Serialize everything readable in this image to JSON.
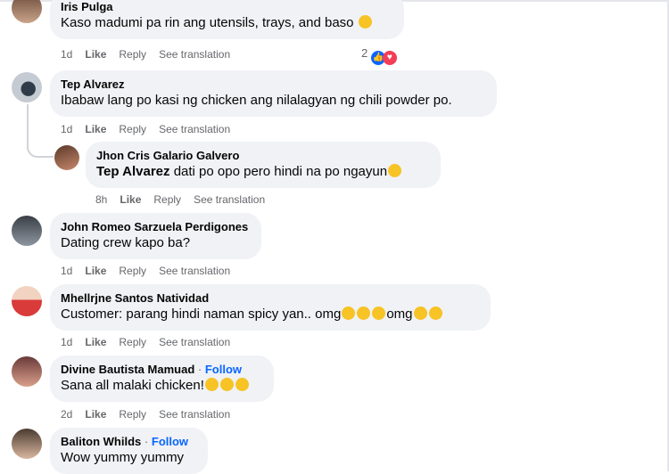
{
  "comments": [
    {
      "name": "Iris Pulga",
      "text": "Kaso madumi pa rin ang utensils, trays, and baso",
      "actions": {
        "time": "1d",
        "like": "Like",
        "reply": "Reply",
        "translate": "See translation"
      },
      "reaction_count": "2",
      "emoji": "sad-tear-emoji"
    },
    {
      "name": "Tep Alvarez",
      "text": "Ibabaw lang po kasi ng chicken ang nilalagyan ng chili powder po.",
      "actions": {
        "time": "1d",
        "like": "Like",
        "reply": "Reply",
        "translate": "See translation"
      }
    },
    {
      "name": "Jhon Cris Galario Galvero",
      "tag": "Tep Alvarez",
      "text": "dati po opo pero hindi na po ngayun",
      "actions": {
        "time": "8h",
        "like": "Like",
        "reply": "Reply",
        "translate": "See translation"
      }
    },
    {
      "name": "John Romeo Sarzuela Perdigones",
      "text": "Dating crew kapo ba?",
      "actions": {
        "time": "1d",
        "like": "Like",
        "reply": "Reply",
        "translate": "See translation"
      }
    },
    {
      "name": "Mhellrjne Santos Natividad",
      "text_a": "Customer: parang hindi naman spicy yan.. omg",
      "text_b": "omg",
      "actions": {
        "time": "1d",
        "like": "Like",
        "reply": "Reply",
        "translate": "See translation"
      }
    },
    {
      "name": "Divine Bautista Mamuad",
      "follow": "Follow",
      "text": "Sana all malaki chicken!",
      "actions": {
        "time": "2d",
        "like": "Like",
        "reply": "Reply",
        "translate": "See translation"
      }
    },
    {
      "name": "Baliton Whilds",
      "follow": "Follow",
      "text": "Wow yummy yummy"
    }
  ],
  "separator": "·",
  "colors": {
    "bubble": "#f0f2f5",
    "link": "#0866ff",
    "meta": "#65676b",
    "like": "#0866ff",
    "love": "#f33e58"
  }
}
